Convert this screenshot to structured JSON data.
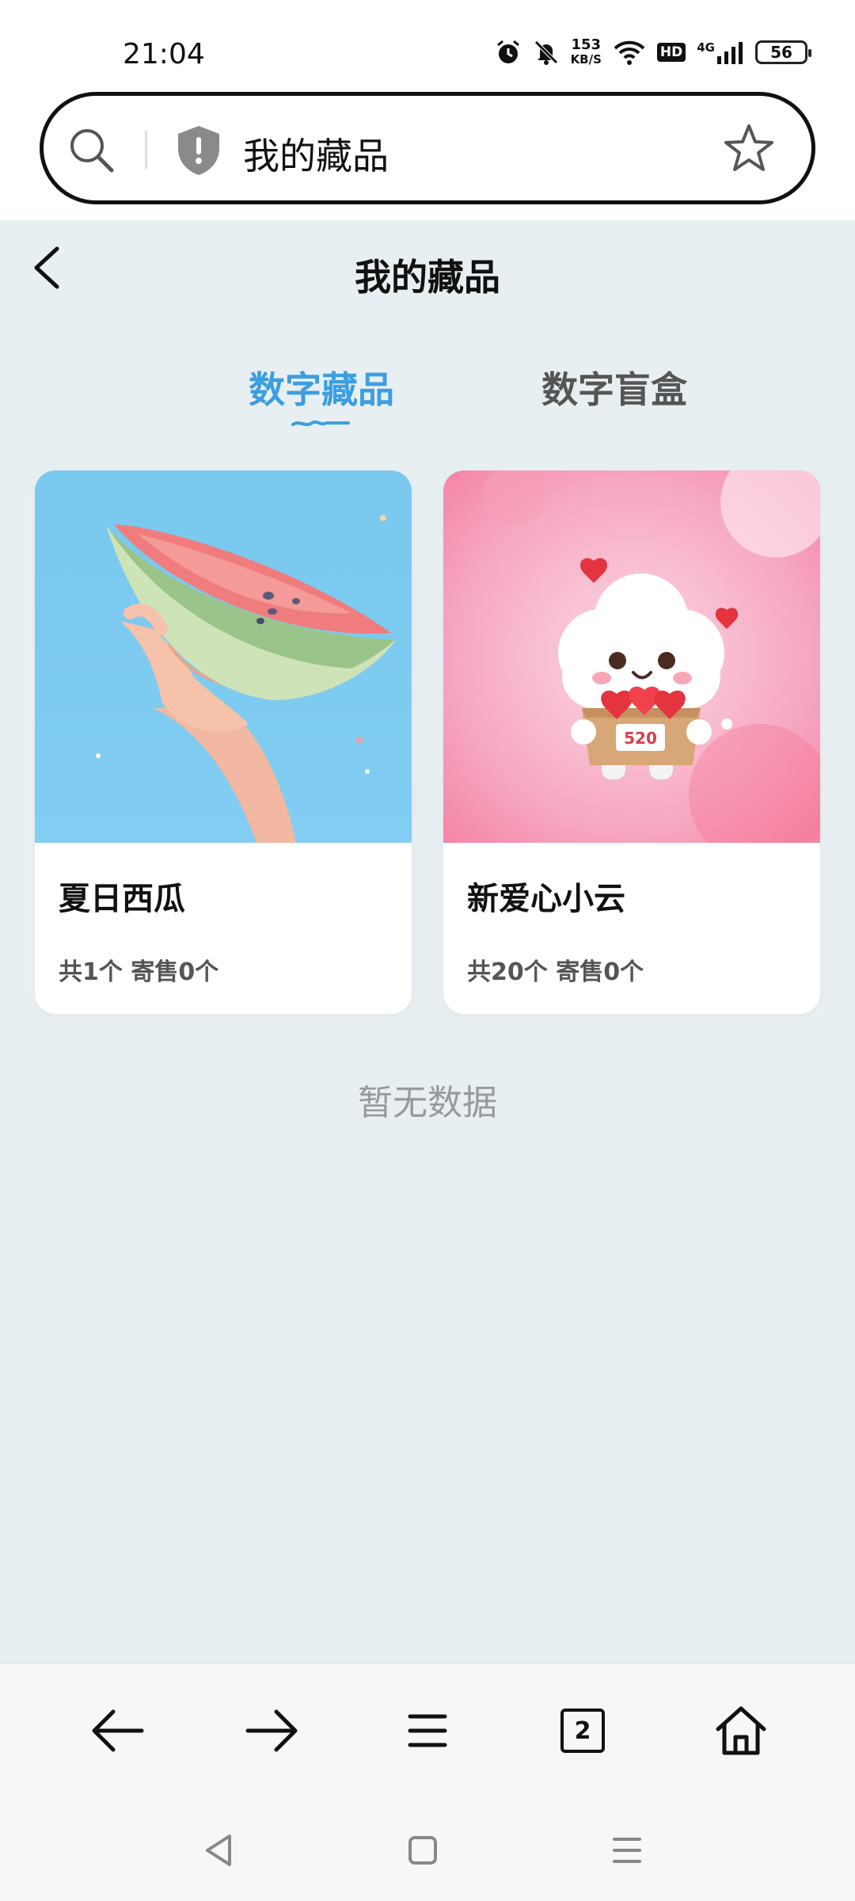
{
  "status_bar": {
    "time": "21:04",
    "net_speed_value": "153",
    "net_speed_unit": "KB/S",
    "hd_label": "HD",
    "signal_label": "4G",
    "battery_level": "56"
  },
  "address_bar": {
    "text": "我的藏品",
    "icons": [
      "search-icon",
      "shield-icon",
      "star-icon"
    ]
  },
  "header": {
    "title": "我的藏品"
  },
  "tabs": [
    {
      "label": "数字藏品",
      "active": true
    },
    {
      "label": "数字盲盒",
      "active": false
    }
  ],
  "collections": [
    {
      "name": "夏日西瓜",
      "stats": "共1个 寄售0个",
      "image": "watermelon-image"
    },
    {
      "name": "新爱心小云",
      "stats": "共20个 寄售0个",
      "image": "cloud-heart-image",
      "box_label": "520"
    }
  ],
  "empty_message": "暂无数据",
  "toolbar": {
    "tab_count": "2",
    "icons": [
      "back-arrow-icon",
      "forward-arrow-icon",
      "menu-icon",
      "tabs-icon",
      "home-icon"
    ]
  },
  "system_nav": {
    "icons": [
      "nav-back-icon",
      "nav-home-icon",
      "nav-recents-icon"
    ]
  },
  "colors": {
    "accent": "#3d9ee0",
    "page_bg": "#e8eff3",
    "card_bg": "#ffffff"
  }
}
